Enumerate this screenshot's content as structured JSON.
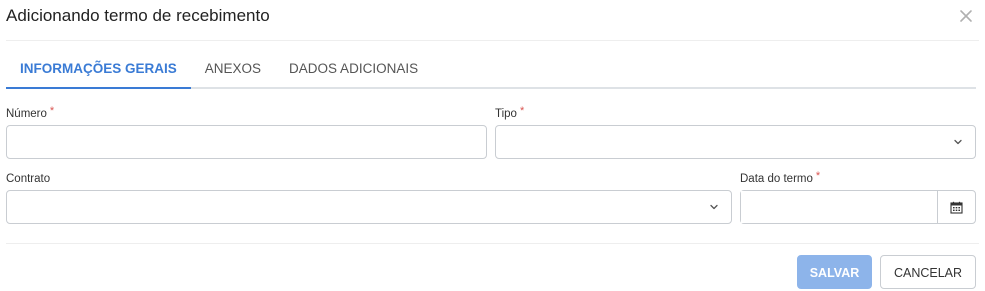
{
  "modal": {
    "title": "Adicionando termo de recebimento",
    "close_icon": "close-icon"
  },
  "tabs": [
    {
      "label": "INFORMAÇÕES GERAIS",
      "active": true
    },
    {
      "label": "ANEXOS",
      "active": false
    },
    {
      "label": "DADOS ADICIONAIS",
      "active": false
    }
  ],
  "form": {
    "numero": {
      "label": "Número",
      "required": "*",
      "value": ""
    },
    "tipo": {
      "label": "Tipo",
      "required": "*",
      "value": "",
      "icon": "chevron-down-icon"
    },
    "contrato": {
      "label": "Contrato",
      "value": "",
      "icon": "chevron-down-icon"
    },
    "data_termo": {
      "label": "Data do termo",
      "required": "*",
      "value": "",
      "icon": "calendar-icon"
    }
  },
  "footer": {
    "save_label": "SALVAR",
    "cancel_label": "CANCELAR"
  },
  "colors": {
    "accent": "#3a7bd5",
    "save_button": "#8db4ea",
    "required": "#d9534f"
  }
}
